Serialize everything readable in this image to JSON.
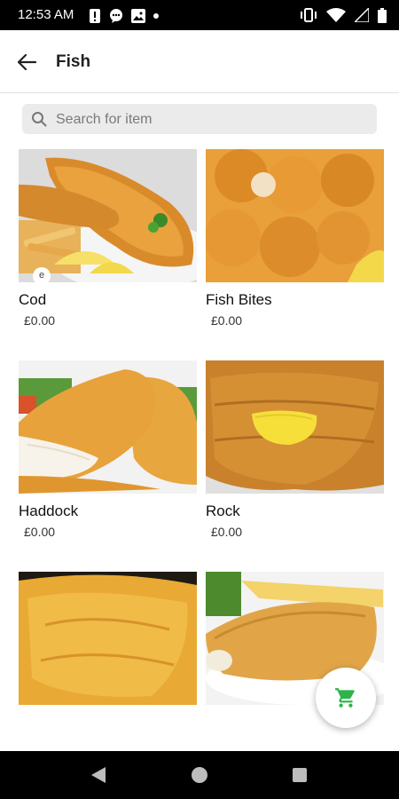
{
  "status_bar": {
    "time": "12:53 AM",
    "icons": [
      "alert-icon",
      "chat-icon",
      "image-icon",
      "dot-icon",
      "vibrate-icon",
      "wifi-icon",
      "signal-icon",
      "battery-icon"
    ]
  },
  "app_bar": {
    "title": "Fish",
    "back_icon": "arrow-back-icon"
  },
  "search": {
    "placeholder": "Search for item",
    "value": ""
  },
  "items": [
    {
      "name": "Cod",
      "price": "£0.00",
      "badge": "e"
    },
    {
      "name": "Fish Bites",
      "price": "£0.00"
    },
    {
      "name": "Haddock",
      "price": "£0.00"
    },
    {
      "name": "Rock",
      "price": "£0.00"
    },
    {
      "name": "",
      "price": ""
    },
    {
      "name": "",
      "price": ""
    }
  ],
  "fab": {
    "icon": "cart-icon",
    "color": "#2db34a"
  },
  "nav": {
    "icons": [
      "nav-back-icon",
      "nav-home-icon",
      "nav-recent-icon"
    ]
  }
}
